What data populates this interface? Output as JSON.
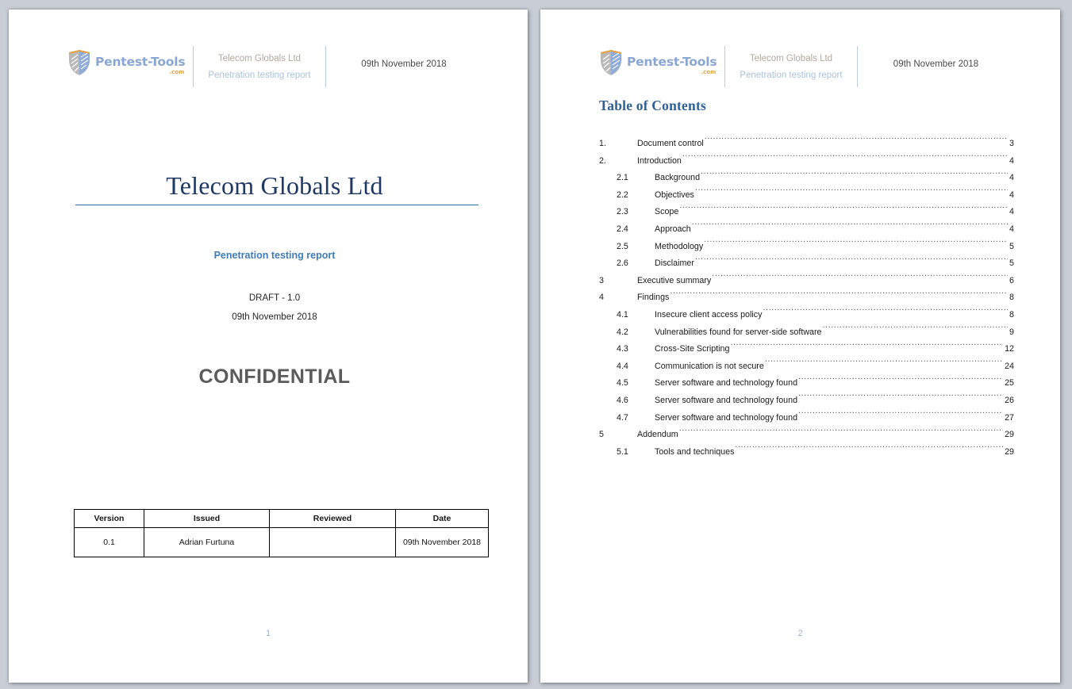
{
  "document": {
    "header": {
      "logo_wordmark": "Pentest-Tools",
      "logo_dotcom": ".com",
      "client_name": "Telecom Globals Ltd",
      "client_subtitle": "Penetration testing report",
      "date": "09th November 2018"
    },
    "accent_colors": {
      "title_navy": "#1f3864",
      "rule_blue": "#3a6ea8",
      "subtitle_blue": "#3d7cb8",
      "toc_heading_blue": "#2e6096",
      "confidential_gray": "#5b5b5b",
      "logo_blue": "#8aa7d4",
      "logo_orange": "#e8a33d"
    }
  },
  "cover": {
    "title": "Telecom Globals Ltd",
    "subtitle": "Penetration testing report",
    "version_line": "DRAFT - 1.0",
    "date_line": "09th November 2018",
    "classification": "CONFIDENTIAL",
    "page_number": "1",
    "version_table": {
      "headers": [
        "Version",
        "Issued",
        "Reviewed",
        "Date"
      ],
      "rows": [
        {
          "version": "0.1",
          "issued": "Adrian Furtuna",
          "reviewed": "",
          "date": "09th November 2018"
        }
      ]
    }
  },
  "toc": {
    "heading": "Table of Contents",
    "page_number": "2",
    "entries": [
      {
        "number": "1.",
        "label": "Document control",
        "page": "3",
        "level": 1
      },
      {
        "number": "2.",
        "label": "Introduction",
        "page": "4",
        "level": 1
      },
      {
        "number": "2.1",
        "label": "Background",
        "page": "4",
        "level": 2
      },
      {
        "number": "2.2",
        "label": "Objectives",
        "page": "4",
        "level": 2
      },
      {
        "number": "2.3",
        "label": "Scope",
        "page": "4",
        "level": 2
      },
      {
        "number": "2.4",
        "label": "Approach",
        "page": "4",
        "level": 2
      },
      {
        "number": "2.5",
        "label": "Methodology",
        "page": "5",
        "level": 2
      },
      {
        "number": "2.6",
        "label": "Disclaimer",
        "page": "5",
        "level": 2
      },
      {
        "number": "3",
        "label": "Executive summary",
        "page": "6",
        "level": 1
      },
      {
        "number": "4",
        "label": "Findings",
        "page": "8",
        "level": 1
      },
      {
        "number": "4.1",
        "label": "Insecure client access policy",
        "page": "8",
        "level": 2
      },
      {
        "number": "4.2",
        "label": "Vulnerabilities found for server-side software",
        "page": "9",
        "level": 2
      },
      {
        "number": "4.3",
        "label": "Cross-Site Scripting",
        "page": "12",
        "level": 2
      },
      {
        "number": "4.4",
        "label": "Communication is not secure",
        "page": "24",
        "level": 2
      },
      {
        "number": "4.5",
        "label": "Server software and technology found",
        "page": "25",
        "level": 2
      },
      {
        "number": "4.6",
        "label": "Server software and technology found",
        "page": "26",
        "level": 2
      },
      {
        "number": "4.7",
        "label": "Server software and technology found",
        "page": "27",
        "level": 2
      },
      {
        "number": "5",
        "label": "Addendum",
        "page": "29",
        "level": 1
      },
      {
        "number": "5.1",
        "label": "Tools and techniques",
        "page": "29",
        "level": 2
      }
    ]
  }
}
